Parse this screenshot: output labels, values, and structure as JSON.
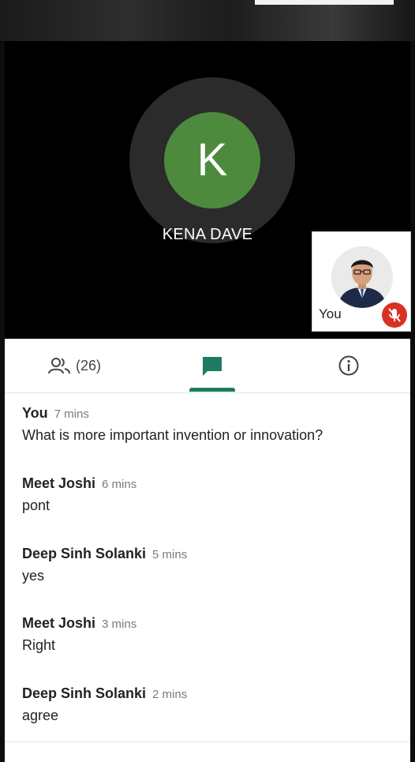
{
  "call": {
    "avatar_letter": "K",
    "caller_name": "KENA DAVE",
    "avatar_color": "#4e8a3e",
    "self_label": "You",
    "self_mic_icon": "mic-off-icon"
  },
  "tabs": {
    "people_icon": "people-icon",
    "people_count": "(26)",
    "chat_icon": "chat-icon",
    "info_icon": "info-icon",
    "active": "chat",
    "accent": "#1e7a63"
  },
  "messages": [
    {
      "sender": "You",
      "time": "7 mins",
      "text": "What is more important invention or innovation?"
    },
    {
      "sender": "Meet Joshi",
      "time": "6 mins",
      "text": "pont"
    },
    {
      "sender": "Deep Sinh Solanki",
      "time": "5 mins",
      "text": "yes"
    },
    {
      "sender": "Meet Joshi",
      "time": "3 mins",
      "text": "Right"
    },
    {
      "sender": "Deep Sinh Solanki",
      "time": "2 mins",
      "text": "agree"
    }
  ]
}
